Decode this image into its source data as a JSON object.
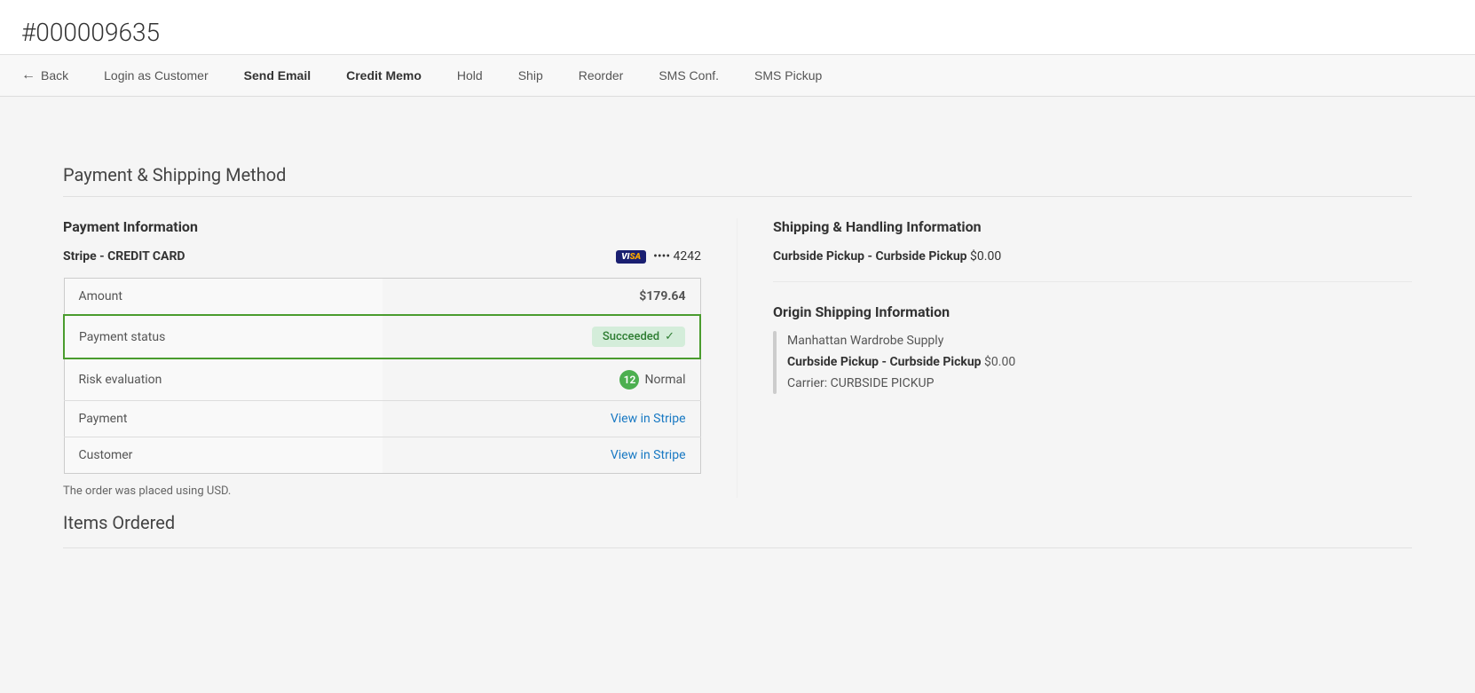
{
  "page": {
    "order_number": "#000009635",
    "action_bar": {
      "back_label": "Back",
      "login_as_customer": "Login as Customer",
      "send_email": "Send Email",
      "credit_memo": "Credit Memo",
      "hold": "Hold",
      "ship": "Ship",
      "reorder": "Reorder",
      "sms_conf": "SMS Conf.",
      "sms_pickup": "SMS Pickup"
    }
  },
  "payment_shipping": {
    "section_title": "Payment & Shipping Method",
    "payment": {
      "subsection_title": "Payment Information",
      "method_label": "Stripe - CREDIT CARD",
      "card_dots": "•••• 4242",
      "visa_text": "VISA",
      "table": {
        "rows": [
          {
            "label": "Amount",
            "value": "$179.64",
            "type": "amount"
          },
          {
            "label": "Payment status",
            "value": "Succeeded",
            "type": "status",
            "check": "✓"
          },
          {
            "label": "Risk evaluation",
            "value": "Normal",
            "risk_score": "12",
            "type": "risk"
          },
          {
            "label": "Payment",
            "value": "View in Stripe",
            "type": "link"
          },
          {
            "label": "Customer",
            "value": "View in Stripe",
            "type": "link"
          }
        ]
      },
      "usd_note": "The order was placed using USD."
    },
    "shipping": {
      "subsection_title": "Shipping & Handling Information",
      "method": "Curbside Pickup - Curbside Pickup",
      "price": "$0.00",
      "origin_title": "Origin Shipping Information",
      "origin_company": "Manhattan Wardrobe Supply",
      "origin_method": "Curbside Pickup - Curbside Pickup",
      "origin_price": "$0.00",
      "origin_carrier_label": "Carrier:",
      "origin_carrier": "CURBSIDE PICKUP"
    }
  },
  "items_ordered": {
    "section_title": "Items Ordered"
  }
}
